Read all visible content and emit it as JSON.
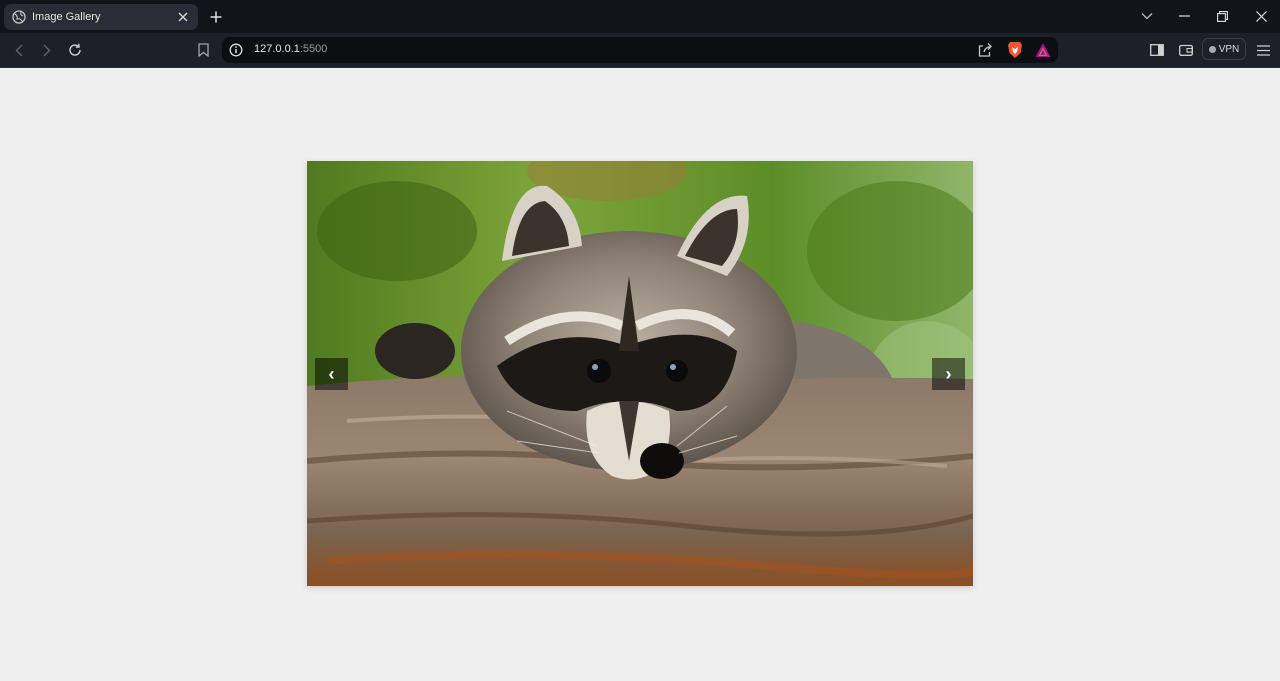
{
  "browser": {
    "tab": {
      "title": "Image Gallery",
      "icon": "globe-icon"
    },
    "new_tab_icon": "plus-icon",
    "address": {
      "host": "127.0.0.1",
      "port": ":5500"
    },
    "vpn_label": "VPN",
    "colors": {
      "chrome": "#12141a",
      "toolbar": "#1e2027",
      "url_field": "#0d0e12",
      "brave_orange": "#fb542b"
    }
  },
  "gallery": {
    "prev_label": "‹",
    "next_label": "›",
    "image_subject": "raccoon-on-log",
    "background": "#efefef"
  }
}
